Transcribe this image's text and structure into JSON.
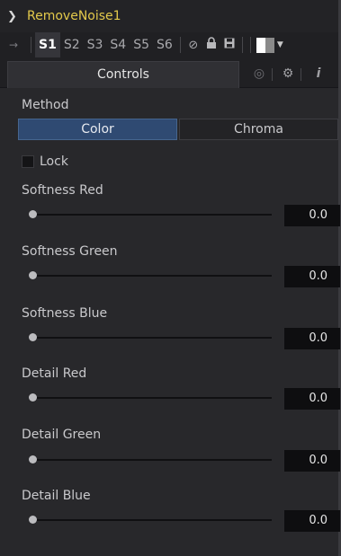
{
  "header": {
    "title": "RemoveNoise1",
    "collapse_icon": "chevron-down-icon"
  },
  "toolbar": {
    "pin_icon": "pin-icon",
    "slots": [
      "S1",
      "S2",
      "S3",
      "S4",
      "S5",
      "S6"
    ],
    "active_slot": "S1",
    "icons": [
      "bypass-icon",
      "lock-icon",
      "save-icon"
    ],
    "swatch_colors": [
      "#ffffff",
      "#8a8a8a"
    ]
  },
  "tabs": {
    "active": "Controls",
    "other_icons": [
      "nodes-icon",
      "gear-icon",
      "info-icon"
    ]
  },
  "method": {
    "label": "Method",
    "options": [
      "Color",
      "Chroma"
    ],
    "selected": "Color"
  },
  "lock": {
    "label": "Lock",
    "checked": false
  },
  "sliders": [
    {
      "label": "Softness Red",
      "value": "0.0",
      "fraction": 0
    },
    {
      "label": "Softness Green",
      "value": "0.0",
      "fraction": 0
    },
    {
      "label": "Softness Blue",
      "value": "0.0",
      "fraction": 0
    },
    {
      "label": "Detail Red",
      "value": "0.0",
      "fraction": 0
    },
    {
      "label": "Detail Green",
      "value": "0.0",
      "fraction": 0
    },
    {
      "label": "Detail Blue",
      "value": "0.0",
      "fraction": 0
    }
  ]
}
